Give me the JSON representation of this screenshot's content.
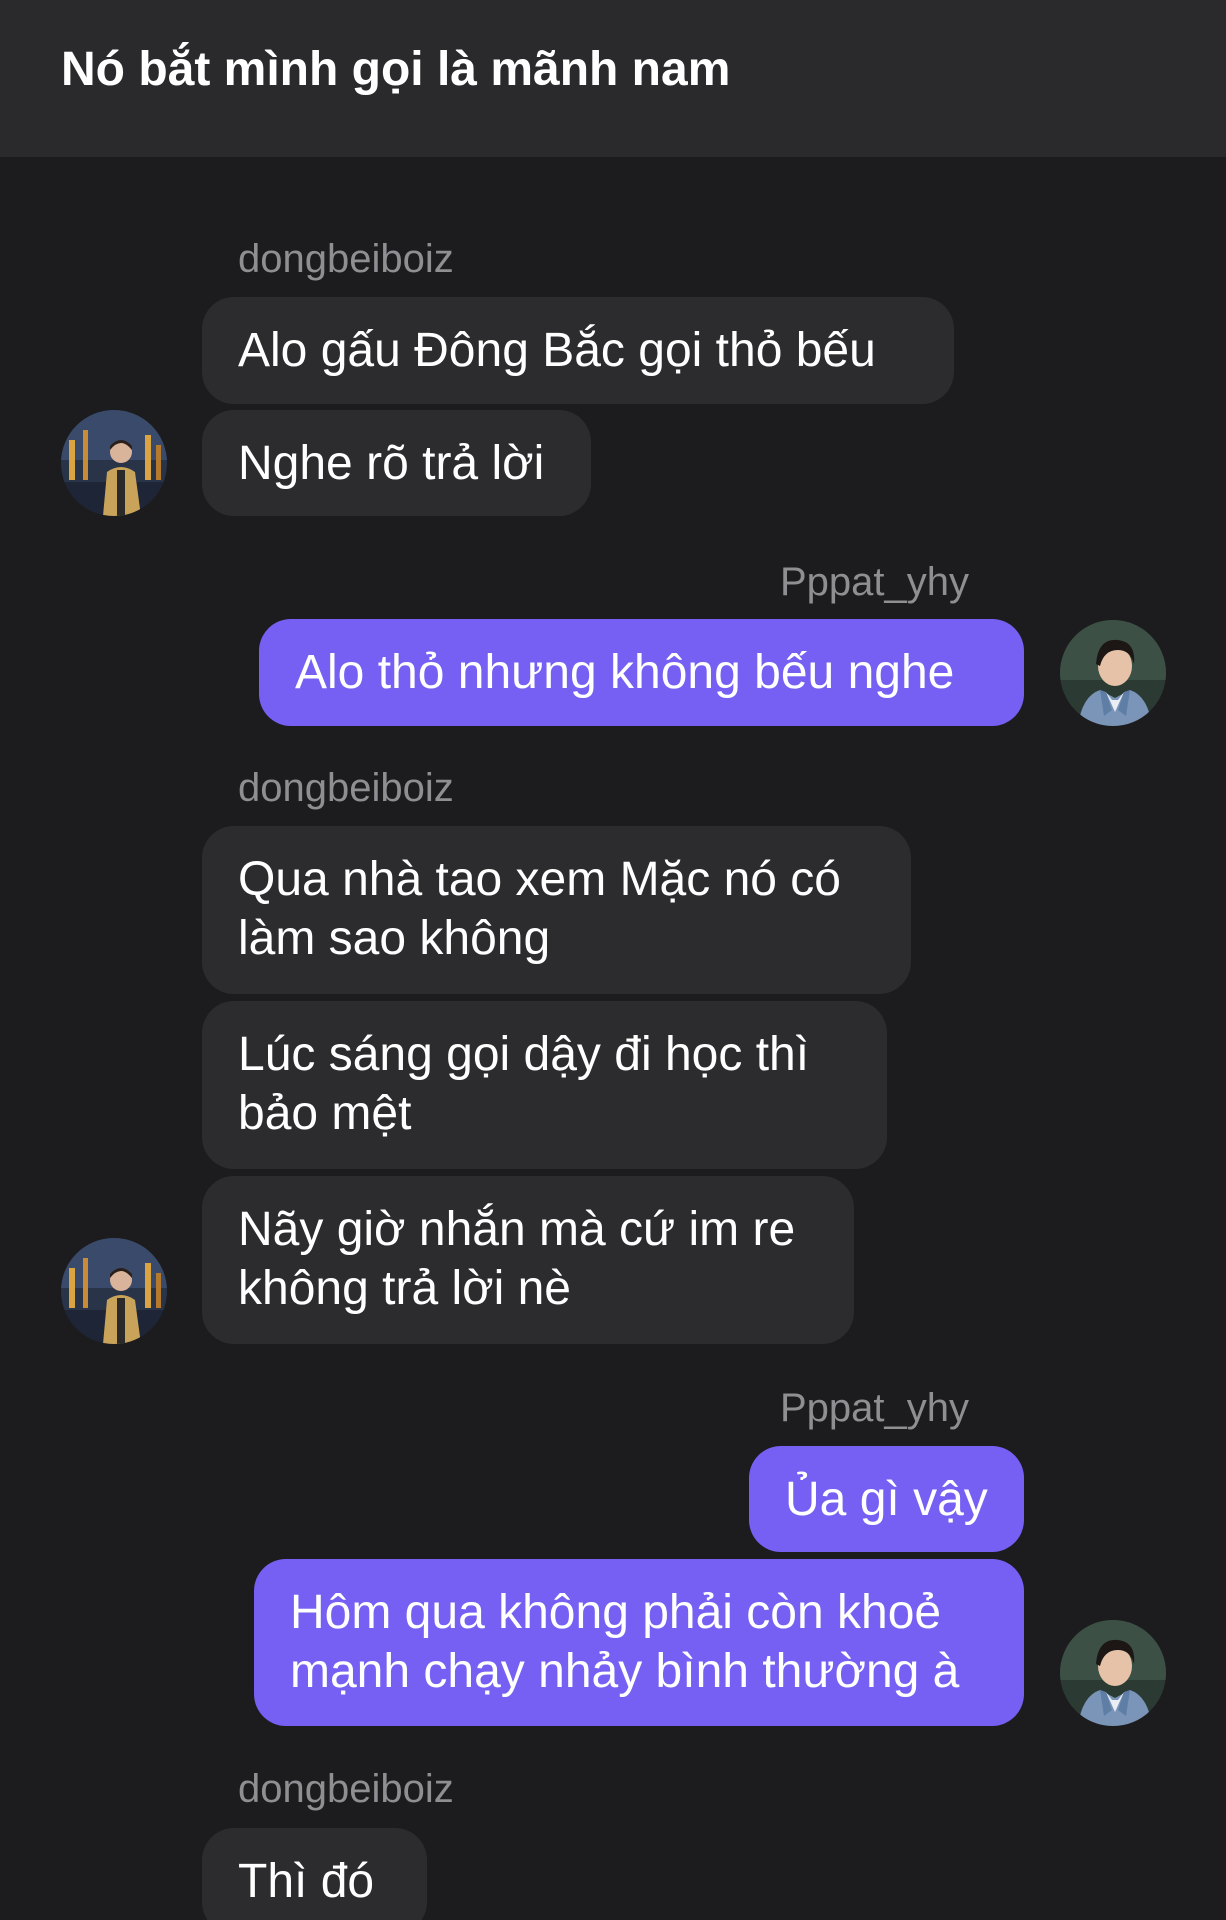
{
  "header": {
    "title": "Nó bắt mình gọi là mãnh nam"
  },
  "messages": [
    {
      "sender": "dongbeiboiz",
      "bubbles": [
        "Alo gấu Đông Bắc gọi thỏ bếu",
        "Nghe rõ trả lời"
      ]
    },
    {
      "sender": "Pppat_yhy",
      "bubbles": [
        "Alo thỏ nhưng không bếu nghe"
      ]
    },
    {
      "sender": "dongbeiboiz",
      "bubbles": [
        {
          "line1": "Qua nhà tao xem Mặc nó có",
          "line2": "làm sao không"
        },
        {
          "line1": "Lúc sáng gọi dậy đi học thì",
          "line2": "bảo mệt"
        },
        {
          "line1": "Nãy giờ nhắn mà cứ im re",
          "line2": "không trả lời nè"
        }
      ]
    },
    {
      "sender": "Pppat_yhy",
      "bubbles": [
        "Ủa gì vậy",
        {
          "line1": "Hôm qua không phải còn khoẻ",
          "line2": "mạnh chạy nhảy bình thường à"
        }
      ]
    },
    {
      "sender": "dongbeiboiz",
      "bubbles": [
        "Thì đó"
      ]
    }
  ],
  "avatars": {
    "dongbeiboiz": "avatar-dongbeiboiz",
    "Pppat_yhy": "avatar-pppat-yhy"
  },
  "colors": {
    "background": "#1c1c1e",
    "header": "#2a2a2c",
    "incoming_bubble": "#2c2c2e",
    "outgoing_bubble": "#7660f4",
    "sender_text": "#8e8e93"
  }
}
